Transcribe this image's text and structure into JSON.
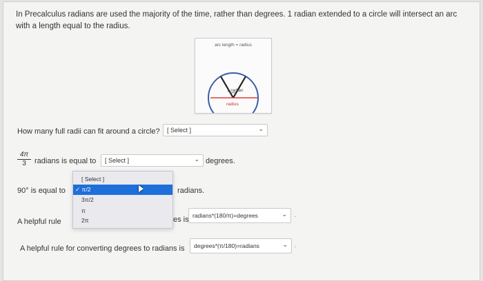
{
  "intro": "In Precalculus radians are used the majority of the time, rather than degrees. 1 radian extended to a circle will intersect an arc with a length equal to the radius.",
  "figure": {
    "title": "arc length = radius",
    "angle_label": "1 radian",
    "base_label": "radius"
  },
  "q1": {
    "text": "How many full radii can fit around a circle?",
    "select": "[ Select ]"
  },
  "q2": {
    "frac_num": "4π",
    "frac_den": "3",
    "text": "radians is equal to",
    "select": "[ Select ]",
    "suffix": "degrees."
  },
  "q3": {
    "prefix": "90° is equal to",
    "suffix": "radians."
  },
  "dropdown": {
    "options": [
      "[ Select ]",
      "✓ π/2",
      "3π/2",
      "π",
      "2π"
    ],
    "selected_index": 1
  },
  "q4": {
    "prefix": "A helpful rule",
    "mid": "es is",
    "select": "radians*(180/π)=degrees"
  },
  "q5": {
    "text": "A helpful rule for converting degrees to radians is",
    "select": "degrees*(π/180)=radians"
  },
  "colors": {
    "selected": "#1e6fd9",
    "radius_line": "#e23b3b"
  }
}
